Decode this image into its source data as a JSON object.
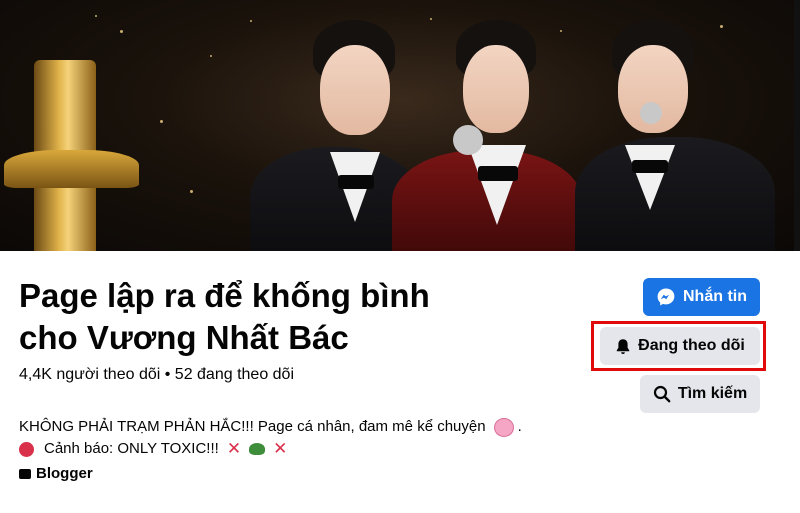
{
  "page": {
    "name_line1": "Page lập ra để khống bình",
    "name_line2": "cho Vương Nhất Bác",
    "stats": "4,4K người theo dõi • 52 đang theo dõi",
    "bio_line1": "KHÔNG PHẢI TRẠM PHẢN HẮC!!! Page cá nhân, đam mê kể chuyện",
    "bio_line2": "Cảnh báo: ONLY TOXIC!!!",
    "category": "Blogger"
  },
  "actions": {
    "message_label": "Nhắn tin",
    "following_label": "Đang theo dõi",
    "search_label": "Tìm kiếm"
  },
  "icons": {
    "message": "messenger-icon",
    "following": "bell-icon",
    "search": "search-icon",
    "category": "category-icon"
  },
  "colors": {
    "primary": "#1b74e4",
    "secondary_button": "#e4e6eb",
    "highlight": "#e00a0a"
  }
}
